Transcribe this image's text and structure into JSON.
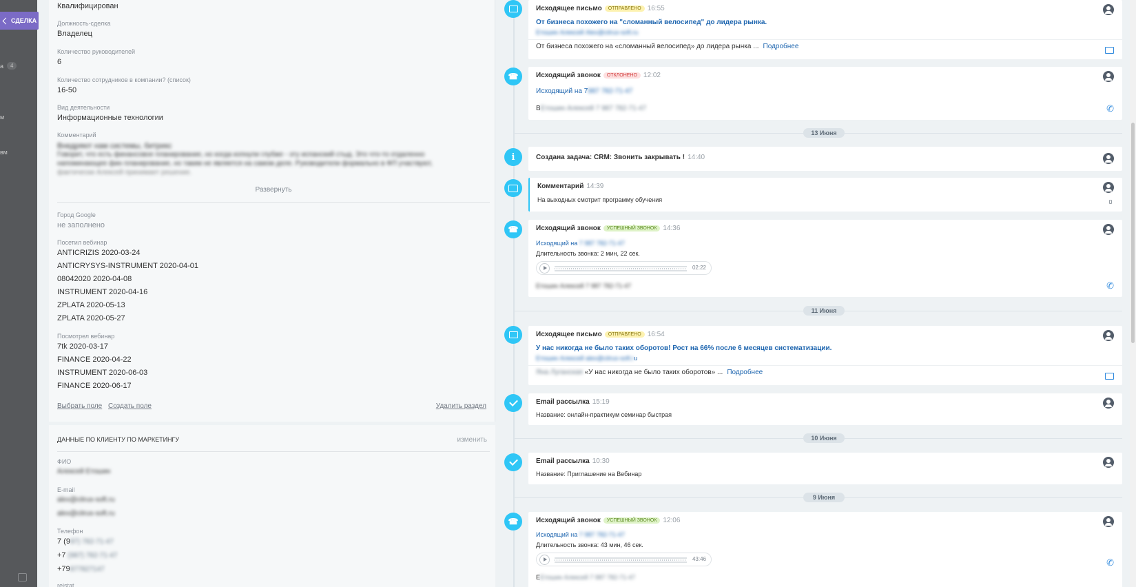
{
  "strip": {
    "back_label": "СДЕЛКА",
    "badge": "4",
    "fragments": [
      "а",
      "м",
      "вм"
    ]
  },
  "card": {
    "top_value": "Квалифицирован",
    "fields": [
      {
        "label": "Должность-сделка",
        "value": "Владелец"
      },
      {
        "label": "Количество руководителей",
        "value": "6"
      },
      {
        "label": "Количество сотрудников в компании? (список)",
        "value": "16-50"
      },
      {
        "label": "Вид деятельности",
        "value": "Информационные технологии"
      }
    ],
    "comment_label": "Комментарий",
    "comment_lines": [
      "Внедряют нам системы, битрикс",
      "Говорит, что есть финансовое планирование, но когда копнули глубже - эту испанский стыд. Это что-то отдаленно",
      "напоминающее фин планирование, но таким не является на самом деле. Руководители формально в ФП участвуют,",
      "фактически Алексей принимает решение."
    ],
    "expand_label": "Развернуть",
    "google_city_label": "Город Google",
    "google_city_value": "не заполнено",
    "webinar_visited_label": "Посетил вебинар",
    "webinar_visited": [
      "ANTICRIZIS 2020-03-24",
      "ANTICRYSYS-INSTRUMENT 2020-04-01",
      "08042020 2020-04-08",
      "INSTRUMENT 2020-04-16",
      "ZPLATA 2020-05-13",
      "ZPLATA 2020-05-27"
    ],
    "webinar_watched_label": "Посмотрел вебинар",
    "webinar_watched": [
      "7tk 2020-03-17",
      "FINANCE 2020-04-22",
      "INSTRUMENT 2020-06-03",
      "FINANCE 2020-06-17"
    ],
    "select_field": "Выбрать поле",
    "create_field": "Создать поле",
    "delete_section": "Удалить раздел"
  },
  "marketing": {
    "title": "ДАННЫЕ ПО КЛИЕНТУ ПО МАРКЕТИНГУ",
    "edit": "изменить",
    "fio_label": "ФИО",
    "fio_value": "Алексей Етошин",
    "email_label": "E-mail",
    "emails": [
      "alex@citrus-soft.ru",
      "alex@citrus-soft.ru"
    ],
    "phone_label": "Телефон",
    "phones": [
      {
        "prefix": "7 (9",
        "rest": "87) 782-71-47"
      },
      {
        "prefix": "+7",
        "rest": "(987) 782-71-47"
      },
      {
        "prefix": "+79",
        "rest": "877827147"
      }
    ],
    "cut_label": "reistat"
  },
  "timeline": {
    "items": [
      {
        "title": "Исходящее письмо",
        "badge": "ОТПРАВЛЕНО",
        "time": "16:55",
        "subject": "От бизнеса похожего на \"сломанный велосипед\" до лидера рынка.",
        "from": "Етошин Алексей Alex@citrus-soft.ru",
        "preview": "От бизнеса похожего на «сломанный велосипед» до лидера рынка ...",
        "more": "Подробнее"
      },
      {
        "title": "Исходящий звонок",
        "badge": "ОТКЛОНЕНО",
        "time": "12:02",
        "call_to": "Исходящий на 7",
        "call_to_blur": "987 782-71-47",
        "contact_prefix": "В",
        "contact_blur": "Етошин Алексей 7 987 782-71-47"
      },
      {
        "title": "Создана задача: CRM: Звонить закрывать !",
        "time": "14:40"
      },
      {
        "title": "Комментарий",
        "time": "14:39",
        "text": "На выходных смотрит программу обучения"
      },
      {
        "title": "Исходящий звонок",
        "badge": "УСПЕШНЫЙ ЗВОНОК",
        "time": "14:36",
        "call_to": "Исходящий на",
        "call_to_blur": "7 987 782-71-47",
        "duration": "Длительность звонка: 2 мин, 22 сек.",
        "audio": "02:22",
        "contact_blur": "Етошин Алексей 7 987 782-71-47"
      },
      {
        "title": "Исходящее письмо",
        "badge": "ОТПРАВЛЕНО",
        "time": "16:54",
        "subject": "У нас никогда не было таких оборотов! Рост на 66% после 6 месяцев систематизации.",
        "from": "Етошин Алексей alex@citrus-soft.r",
        "from_tail": "u",
        "preview_blur": "Яна Луганская",
        "preview": "«У нас никогда не было таких оборотов» ...",
        "more": "Подробнее"
      },
      {
        "title": "Email рассылка",
        "time": "15:19",
        "text": "Название: онлайн-практикум семинар быстрая"
      },
      {
        "title": "Email рассылка",
        "time": "10:30",
        "text": "Название: Приглашение на Вебинар"
      },
      {
        "title": "Исходящий звонок",
        "badge": "УСПЕШНЫЙ ЗВОНОК",
        "time": "12:06",
        "call_to": "Исходящий на",
        "call_to_blur": "7 987 782-71-47",
        "duration": "Длительность звонка: 43 мин, 46 сек.",
        "audio": "43:46",
        "contact_prefix": "Е",
        "contact_blur": "Етошин Алексей 7 987 782-71-47"
      }
    ],
    "dates": [
      "13 Июня",
      "11 Июня",
      "10 Июня",
      "9 Июня"
    ]
  },
  "colors": {
    "accent": "#2fc6f6",
    "link": "#2067b0",
    "back_button": "#7b6bc6",
    "sidebar": "#56585b"
  },
  "icons": [
    "envelope-icon",
    "phone-icon",
    "info-icon",
    "comment-icon",
    "check-icon",
    "user-icon",
    "printer-icon",
    "play-icon"
  ]
}
